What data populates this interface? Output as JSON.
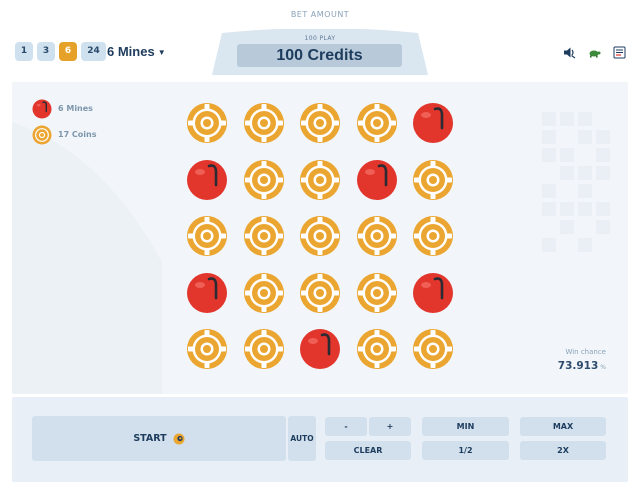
{
  "header": {
    "bet_amount_label": "BET AMOUNT",
    "bet_sub_label": "100 PLAY",
    "bet_value": "100 Credits"
  },
  "mine_pills": [
    {
      "label": "1",
      "active": false
    },
    {
      "label": "3",
      "active": false
    },
    {
      "label": "6",
      "active": true
    },
    {
      "label": "24",
      "active": false
    }
  ],
  "mines_select": {
    "label": "6 Mines",
    "caret": "▼"
  },
  "top_icons": [
    "sound-icon",
    "turtle-icon",
    "rules-icon"
  ],
  "legend": {
    "mines": "6 Mines",
    "coins": "17 Coins"
  },
  "board": {
    "cols": 5,
    "rows": 5,
    "tiles": [
      "coin",
      "coin",
      "coin",
      "coin",
      "mine",
      "mine",
      "coin",
      "coin",
      "mine",
      "coin",
      "coin",
      "coin",
      "coin",
      "coin",
      "coin",
      "mine",
      "coin",
      "coin",
      "coin",
      "mine",
      "coin",
      "coin",
      "mine",
      "coin",
      "coin"
    ]
  },
  "win_chance": {
    "label": "Win chance",
    "value": "73.913",
    "unit": "%"
  },
  "controls": {
    "start": "START",
    "auto": "AUTO",
    "minus": "-",
    "plus": "+",
    "clear": "CLEAR",
    "min": "MIN",
    "half": "1/2",
    "max": "MAX",
    "double": "2X"
  },
  "colors": {
    "accent": "#e5a128",
    "mine_red": "#e2352c",
    "coin_orange": "#eba531",
    "panel": "#d1e0ec",
    "text_dark": "#1e3c5e"
  }
}
